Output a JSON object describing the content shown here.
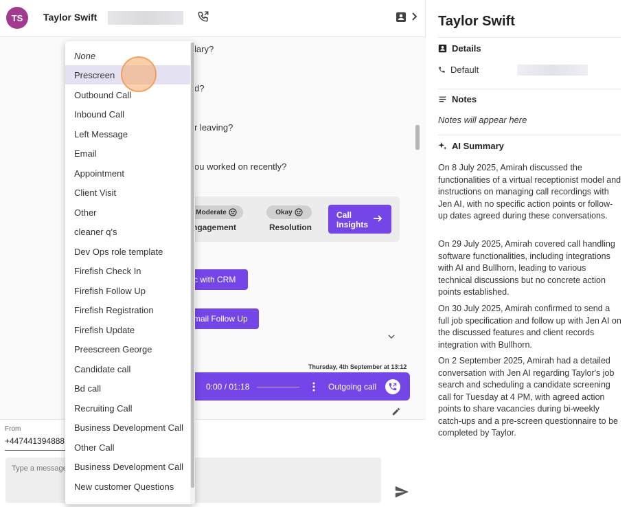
{
  "header": {
    "avatar_initials": "TS",
    "contact_name": "Taylor Swift"
  },
  "chat": {
    "questions": [
      "lary?",
      "d?",
      "r leaving?",
      "ou worked on recently?"
    ],
    "insights": {
      "engagement_level": "Moderate",
      "engagement_label": "ngagement",
      "resolution_level": "Okay",
      "resolution_label": "Resolution",
      "button_label": "Call Insights"
    },
    "sync_button": "c with CRM",
    "email_button": "mail Follow Up",
    "call_timestamp": "Thursday, 4th September at 13:12",
    "audio_time": "0:00 / 01:18",
    "audio_label": "Outgoing call"
  },
  "composer": {
    "from_label": "From",
    "from_value": "+447441394888",
    "placeholder": "Type a message"
  },
  "dropdown": {
    "items": [
      "None",
      "Prescreen",
      "Outbound Call",
      "Inbound Call",
      "Left Message",
      "Email",
      "Appointment",
      "Client Visit",
      "Other",
      "cleaner q's",
      "Dev Ops role template",
      "Firefish Check In",
      "Firefish Follow Up",
      "Firefish Registration",
      "Firefish Update",
      "Preescreen George",
      "Candidate call",
      "Bd call",
      "Recruiting Call",
      "Business Development Call",
      "Other Call",
      "Business Development Call",
      "New customer Questions"
    ]
  },
  "panel": {
    "title": "Taylor Swift",
    "details_heading": "Details",
    "default_label": "Default",
    "notes_heading": "Notes",
    "notes_placeholder": "Notes will appear here",
    "ai_heading": "AI Summary",
    "summary": [
      "On 8 July 2025, Amirah discussed the functionalities of a virtual receptionist model and instructions on managing call recordings with Jen AI, with no specific action points or follow-up dates agreed during these conversations.",
      "On 29 July 2025, Amirah covered call handling software functionalities, including integrations with AI and Bullhorn, leading to various technical discussions but no concrete action points established.",
      "On 30 July 2025, Amirah confirmed to send a full job specification and follow up with Jen AI on the discussed features and client records integration with Bullhorn.",
      "On 2 September 2025, Amirah had a detailed conversation with Jen AI regarding Taylor's job search and scheduling a candidate screening call for Tuesday at 4 PM, with agreed action points to share vacancies during bi-weekly catch-ups and a pre-screen questionnaire to be completed by Taylor."
    ]
  },
  "colors": {
    "accent": "#7446e8",
    "avatar": "#a23a8f",
    "highlight": "#e4e1f3"
  }
}
